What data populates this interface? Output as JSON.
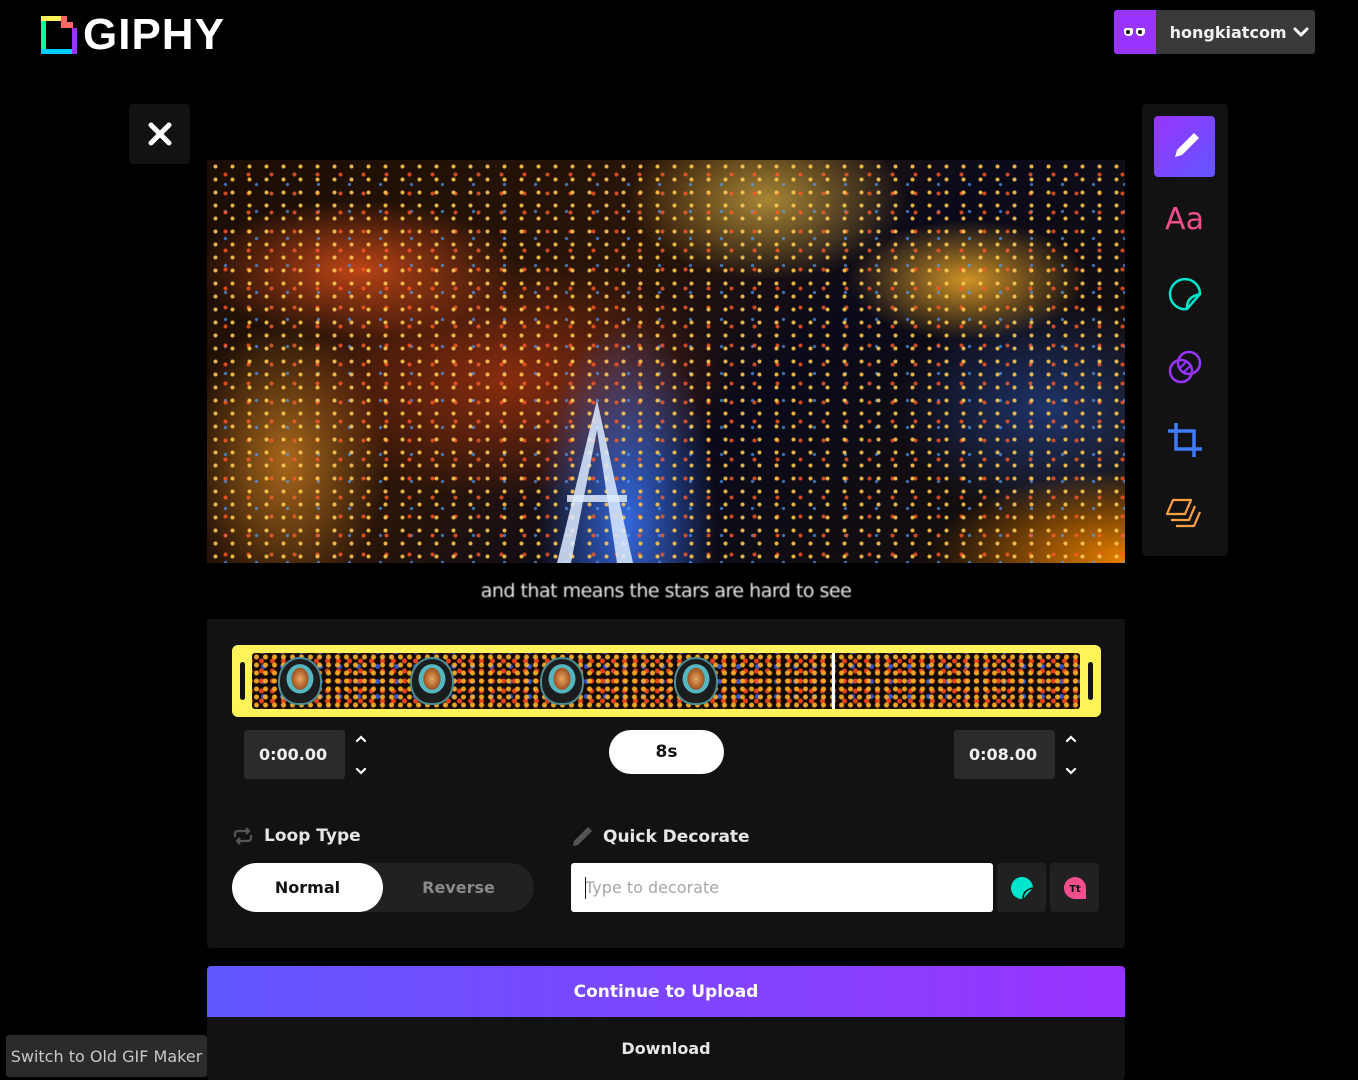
{
  "header": {
    "logo_text": "GIPHY",
    "user": {
      "name": "hongkiatcom",
      "avatar_icon": "eyes-icon",
      "menu_icon": "chevron-down-icon"
    }
  },
  "close_button": {
    "icon": "close-icon",
    "label": "Close"
  },
  "video": {
    "caption": "and that means the stars are hard to see"
  },
  "tools": [
    {
      "name": "draw",
      "icon": "pencil-icon",
      "active": true,
      "color": "#ffffff"
    },
    {
      "name": "caption",
      "icon": "text-icon",
      "label": "Aa",
      "active": false,
      "color": "#f04e8c"
    },
    {
      "name": "stickers",
      "icon": "sticker-icon",
      "active": false,
      "color": "#00e6cc"
    },
    {
      "name": "filters",
      "icon": "filters-icon",
      "active": false,
      "color": "#9933ff"
    },
    {
      "name": "crop",
      "icon": "crop-icon",
      "active": false,
      "color": "#3f7bff"
    },
    {
      "name": "layers",
      "icon": "layers-icon",
      "active": false,
      "color": "#ff9f43"
    }
  ],
  "timeline": {
    "start_time": "0:00.00",
    "end_time": "0:08.00",
    "duration": "8s"
  },
  "loop_type": {
    "label": "Loop Type",
    "options": [
      "Normal",
      "Reverse"
    ],
    "selected": "Normal"
  },
  "quick_decorate": {
    "label": "Quick Decorate",
    "placeholder": "Type to decorate",
    "value": "",
    "buttons": [
      {
        "icon": "sticker-icon",
        "color": "#00e6cc"
      },
      {
        "icon": "text-bubble-icon",
        "label": "Tt",
        "color": "#f04e8c"
      }
    ]
  },
  "actions": {
    "continue_label": "Continue to Upload",
    "download_label": "Download",
    "old_maker_label": "Switch to Old GIF Maker"
  },
  "colors": {
    "accent_start": "#6157ff",
    "accent_end": "#9933ff",
    "timeline_border": "#fff35c"
  }
}
